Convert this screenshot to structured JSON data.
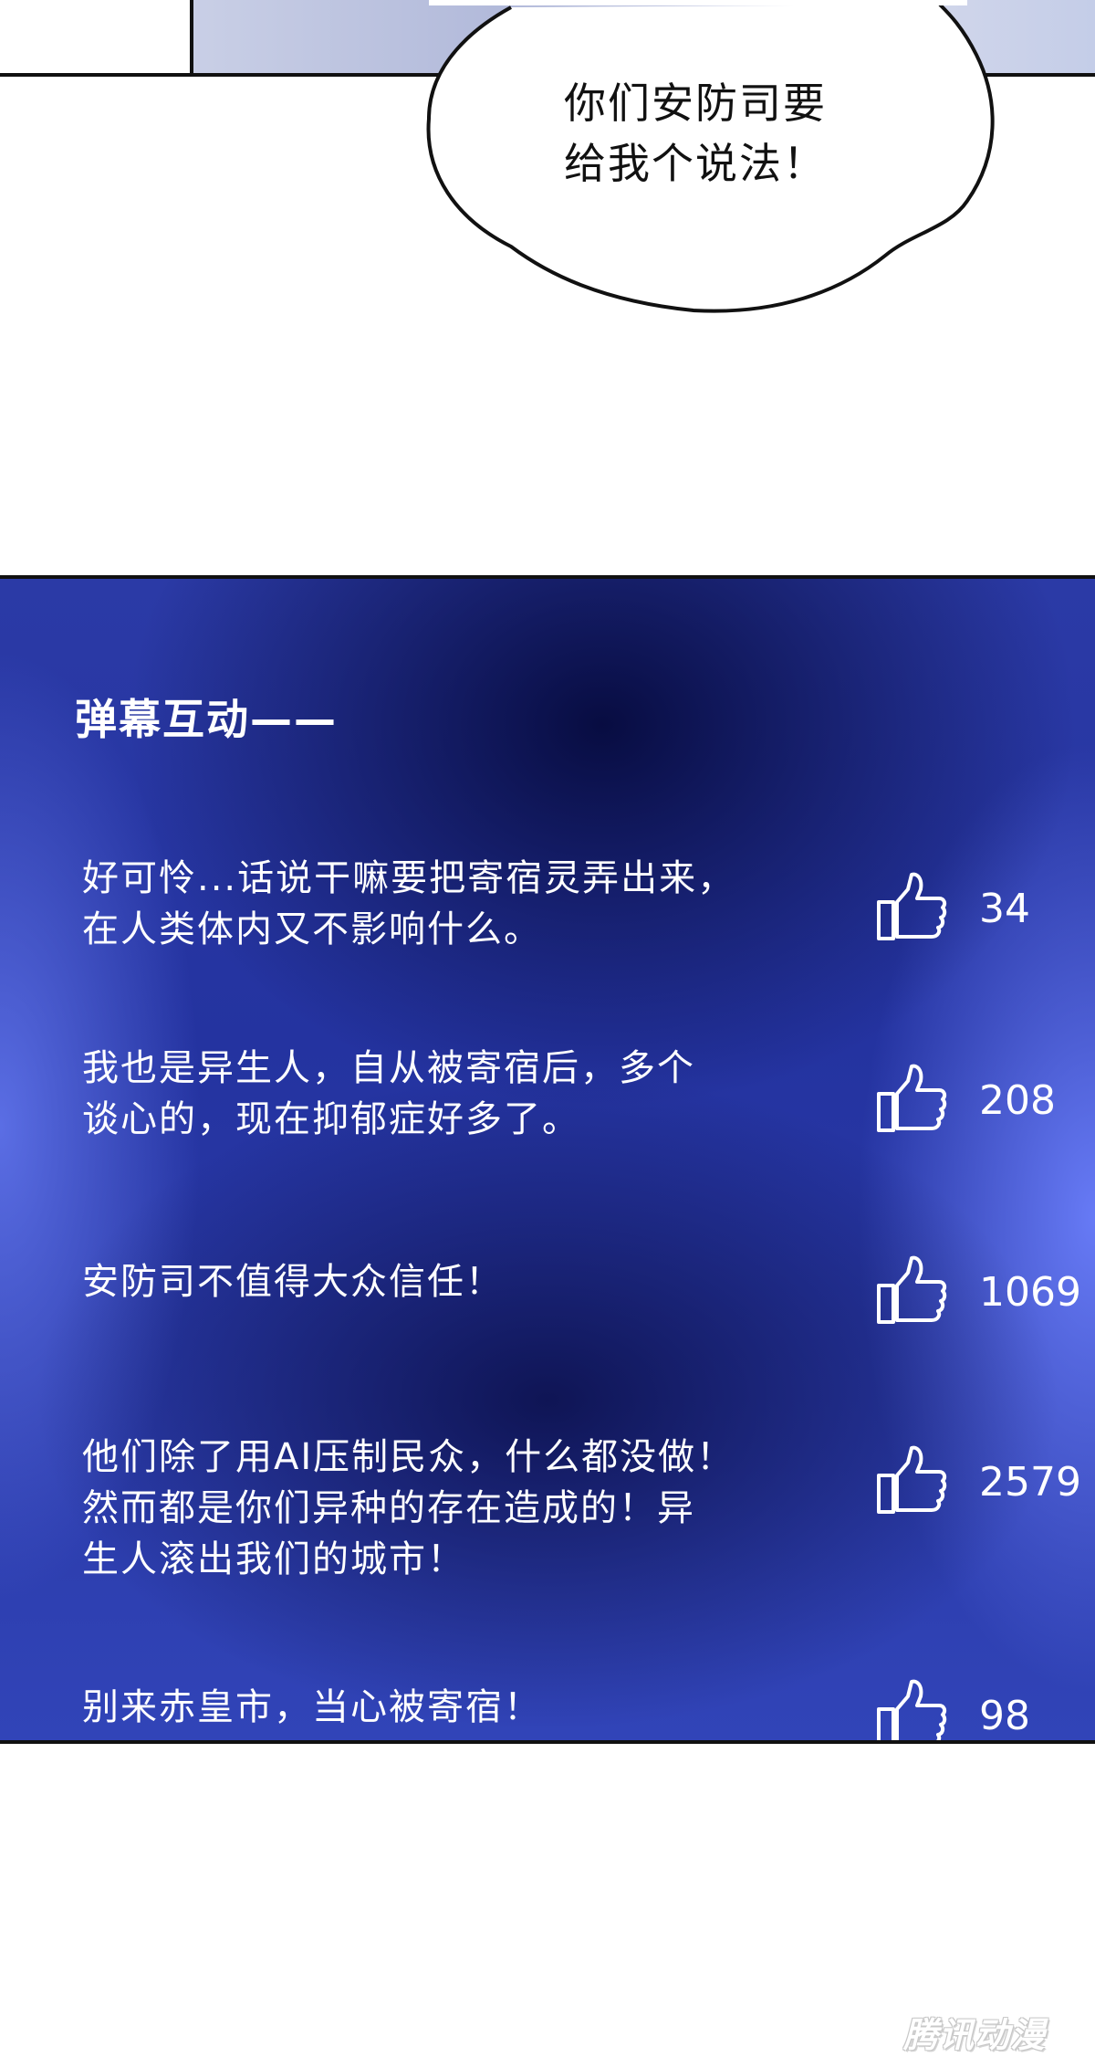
{
  "speech_bubble": {
    "lines": [
      "你们安防司要",
      "给我个说法！"
    ]
  },
  "danmaku": {
    "title": "弹幕互动——",
    "comments": [
      {
        "lines": [
          "好可怜...话说干嘛要把寄宿灵弄出来，",
          "在人类体内又不影响什么。"
        ],
        "likes": "34"
      },
      {
        "lines": [
          "我也是异生人，自从被寄宿后，多个",
          "谈心的，现在抑郁症好多了。"
        ],
        "likes": "208"
      },
      {
        "lines": [
          "安防司不值得大众信任！"
        ],
        "likes": "1069"
      },
      {
        "lines": [
          "他们除了用AI压制民众，什么都没做！",
          "然而都是你们异种的存在造成的！异",
          "生人滚出我们的城市！"
        ],
        "likes": "2579"
      },
      {
        "lines": [
          "别来赤皇市，当心被寄宿！"
        ],
        "likes": "98"
      }
    ]
  },
  "watermark": "腾讯动漫",
  "colors": {
    "panel_dark": "#0a0e46",
    "panel_light": "#6e82ff",
    "text": "#ffffff"
  },
  "icons": {
    "like": "thumbs-up-icon"
  }
}
